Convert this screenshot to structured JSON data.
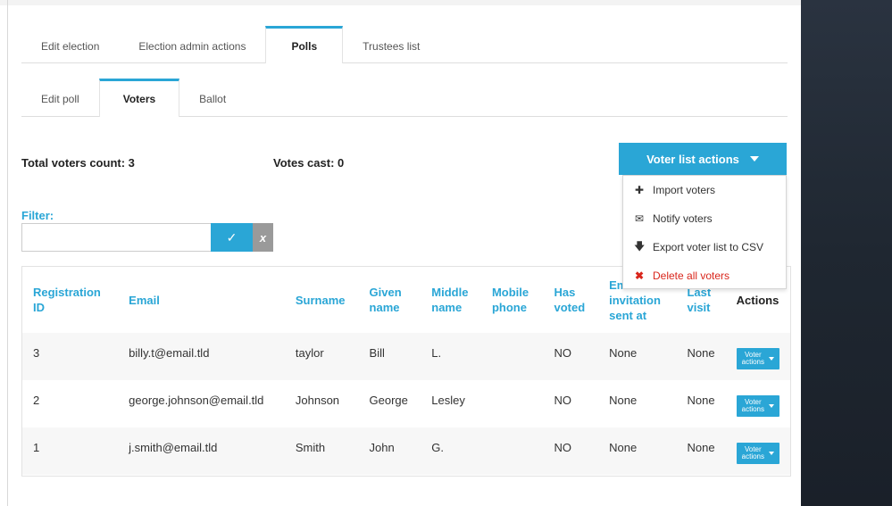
{
  "top_tabs": [
    {
      "label": "Edit election",
      "active": false
    },
    {
      "label": "Election admin actions",
      "active": false
    },
    {
      "label": "Polls",
      "active": true
    },
    {
      "label": "Trustees list",
      "active": false
    }
  ],
  "sub_tabs": [
    {
      "label": "Edit poll",
      "active": false
    },
    {
      "label": "Voters",
      "active": true
    },
    {
      "label": "Ballot",
      "active": false
    }
  ],
  "stats": {
    "total_voters": "Total voters count: 3",
    "votes_cast": "Votes cast: 0"
  },
  "filter": {
    "label": "Filter:",
    "value": "",
    "placeholder": "",
    "ok_icon": "✓",
    "clear_icon": "x"
  },
  "voter_list_actions": {
    "label": "Voter list actions",
    "menu": [
      {
        "icon": "plus-icon",
        "glyph": "✚",
        "label": "Import voters"
      },
      {
        "icon": "envelope-icon",
        "glyph": "✉",
        "label": "Notify voters"
      },
      {
        "icon": "download-icon",
        "glyph": "🡇",
        "label": "Export voter list to CSV"
      },
      {
        "icon": "delete-icon",
        "glyph": "✖",
        "label": "Delete all voters"
      }
    ]
  },
  "table": {
    "headers": [
      "Registration ID",
      "Email",
      "Surname",
      "Given name",
      "Middle name",
      "Mobile phone",
      "Has voted",
      "Email invitation sent at",
      "Last visit",
      "Actions"
    ],
    "rows": [
      {
        "id": "3",
        "email": "billy.t@email.tld",
        "surname": "taylor",
        "given": "Bill",
        "middle": "L.",
        "mobile": "",
        "voted": "NO",
        "invite": "None",
        "visit": "None"
      },
      {
        "id": "2",
        "email": "george.johnson@email.tld",
        "surname": "Johnson",
        "given": "George",
        "middle": "Lesley",
        "mobile": "",
        "voted": "NO",
        "invite": "None",
        "visit": "None"
      },
      {
        "id": "1",
        "email": "j.smith@email.tld",
        "surname": "Smith",
        "given": "John",
        "middle": "G.",
        "mobile": "",
        "voted": "NO",
        "invite": "None",
        "visit": "None"
      }
    ],
    "row_action_line1": "Voter",
    "row_action_line2": "actions"
  },
  "colors": {
    "accent": "#2aa6d6",
    "danger": "#d9261c",
    "sidebar_dark": "#1f2731"
  }
}
